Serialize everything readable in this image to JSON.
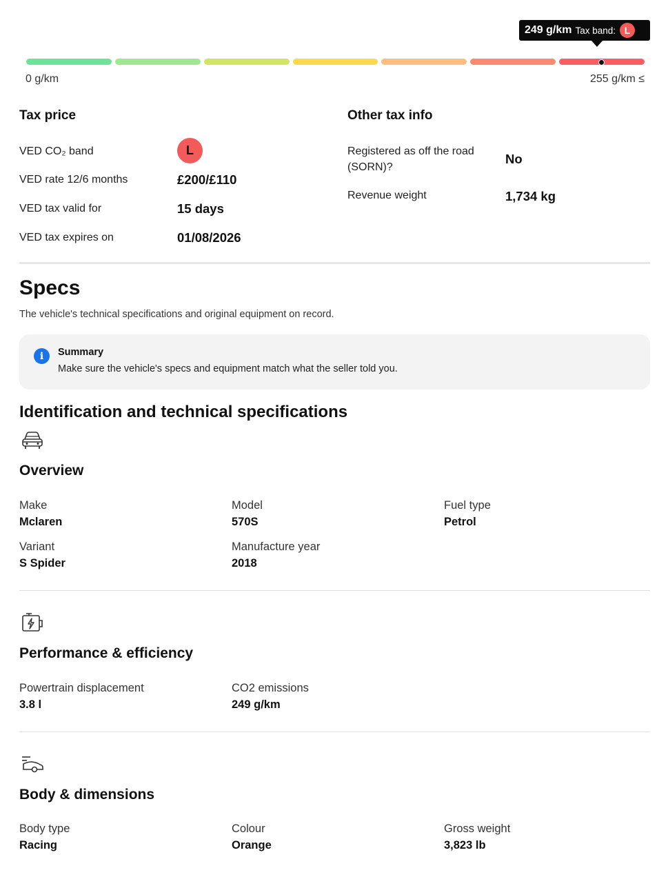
{
  "tax_band_meter": {
    "tooltip_value": "249 g/km",
    "tooltip_label": "Tax band:",
    "tooltip_band": "L",
    "min_label": "0 g/km",
    "max_label": "255 g/km ≤",
    "current_position_fraction": 0.93,
    "segment_colors": [
      "#6ee29a",
      "#9ee88f",
      "#d3e365",
      "#fbd94a",
      "#fcbd7f",
      "#fb8a6d",
      "#fb5c66"
    ]
  },
  "tax_price": {
    "heading": "Tax price",
    "rows": [
      {
        "label": "VED CO₂ band",
        "value": "L"
      },
      {
        "label": "VED rate 12/6 months",
        "value": "£200/£110"
      },
      {
        "label": "VED tax valid for",
        "value": "15 days"
      },
      {
        "label": "VED tax expires on",
        "value": "01/08/2026"
      }
    ]
  },
  "other_tax": {
    "heading": "Other tax info",
    "rows": [
      {
        "label": "Registered as off the road (SORN)?",
        "value": "No"
      },
      {
        "label": "Revenue weight",
        "value": "1,734 kg"
      }
    ]
  },
  "specs": {
    "title": "Specs",
    "description": "The vehicle's technical specifications and original equipment on record.",
    "summary_title": "Summary",
    "summary_text": "Make sure the vehicle's specs and equipment match what the seller told you."
  },
  "identification": {
    "heading": "Identification and technical specifications"
  },
  "overview": {
    "heading": "Overview",
    "fields": [
      {
        "label": "Make",
        "value": "Mclaren"
      },
      {
        "label": "Model",
        "value": "570S"
      },
      {
        "label": "Fuel type",
        "value": "Petrol"
      },
      {
        "label": "Variant",
        "value": "S Spider"
      },
      {
        "label": "Manufacture year",
        "value": "2018"
      }
    ]
  },
  "performance": {
    "heading": "Performance & efficiency",
    "fields": [
      {
        "label": "Powertrain displacement",
        "value": "3.8 l"
      },
      {
        "label": "CO2 emissions",
        "value": "249 g/km"
      }
    ]
  },
  "body": {
    "heading": "Body & dimensions",
    "fields": [
      {
        "label": "Body type",
        "value": "Racing"
      },
      {
        "label": "Colour",
        "value": "Orange"
      },
      {
        "label": "Gross weight",
        "value": "3,823 lb"
      }
    ]
  },
  "icons": {
    "overview": "car-front-icon",
    "performance": "engine-icon",
    "body": "car-side-speed-icon",
    "info": "info-icon"
  }
}
